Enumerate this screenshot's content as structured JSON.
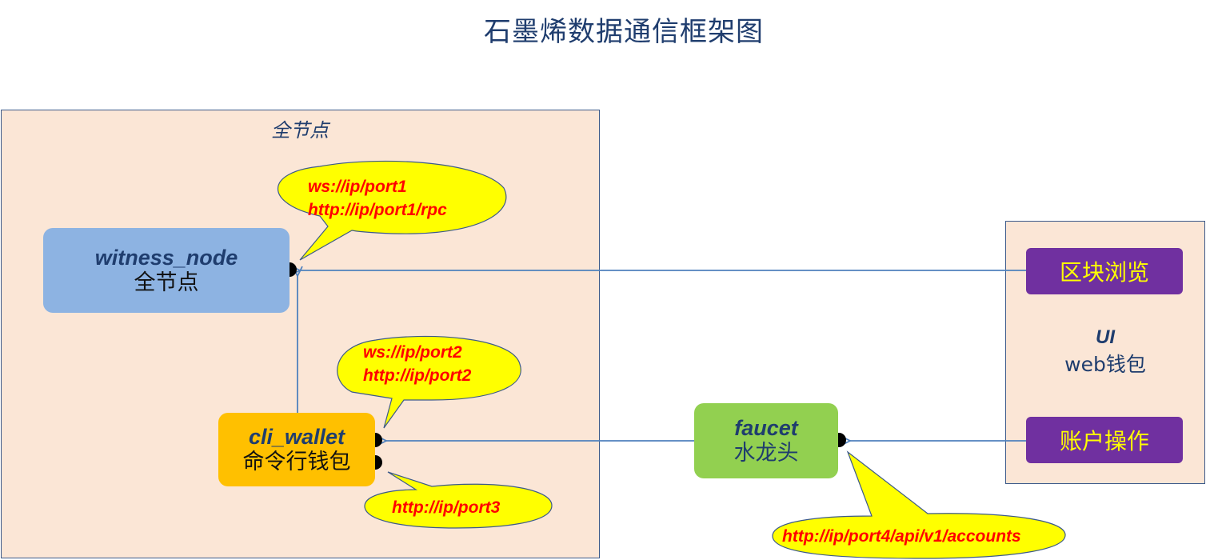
{
  "title": "石墨烯数据通信框架图",
  "full_node_group": {
    "title": "全节点"
  },
  "nodes": {
    "witness_node": {
      "name": "witness_node",
      "label": "全节点"
    },
    "cli_wallet": {
      "name": "cli_wallet",
      "label": "命令行钱包"
    },
    "faucet": {
      "name": "faucet",
      "label": "水龙头"
    }
  },
  "callouts": {
    "witness": [
      "ws://ip/port1",
      "http://ip/port1/rpc"
    ],
    "cli_top": [
      "ws://ip/port2",
      "http://ip/port2"
    ],
    "cli_bottom": [
      "http://ip/port3"
    ],
    "faucet": [
      "http://ip/port4/api/v1/accounts"
    ]
  },
  "ui_group": {
    "title": "UI",
    "subtitle": "web钱包",
    "buttons": {
      "block_browse": "区块浏览",
      "account_ops": "账户操作"
    }
  },
  "colors": {
    "title": "#1f3d6e",
    "frame_fill": "#fbe6d6",
    "frame_border": "#3c5a8a",
    "witness_node": "#8db3e2",
    "cli_wallet": "#ffc000",
    "faucet": "#92d050",
    "purple_button": "#7030a0",
    "button_text": "#ffff00",
    "callout_fill": "#ffff00",
    "callout_text": "#ff0000",
    "arrow": "#4f81bd"
  }
}
